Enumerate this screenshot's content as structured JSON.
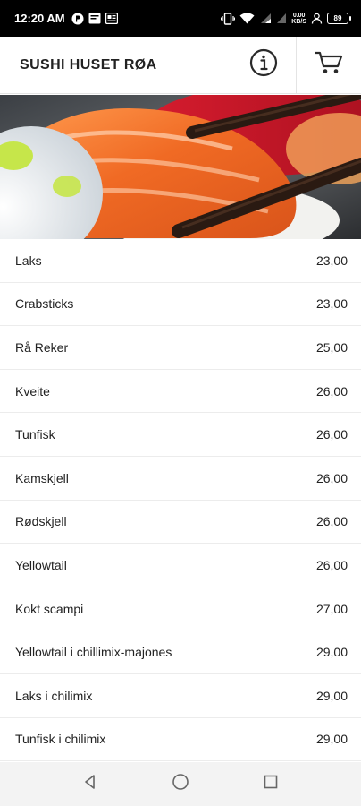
{
  "status_bar": {
    "time": "12:20 AM",
    "network_speed_value": "0.00",
    "network_speed_unit": "KB/S",
    "battery": "89",
    "icons": [
      "p-icon",
      "message-icon",
      "news-icon",
      "vibrate-icon",
      "wifi-icon",
      "signal-icon",
      "signal-icon-2",
      "person-icon"
    ]
  },
  "header": {
    "title": "SUSHI HUSET RØA",
    "icons": [
      "info-icon",
      "cart-icon"
    ]
  },
  "hero": {
    "icon": "sushi-photo"
  },
  "menu": {
    "items": [
      {
        "name": "Laks",
        "price": "23,00"
      },
      {
        "name": "Crabsticks",
        "price": "23,00"
      },
      {
        "name": "Rå Reker",
        "price": "25,00"
      },
      {
        "name": "Kveite",
        "price": "26,00"
      },
      {
        "name": "Tunfisk",
        "price": "26,00"
      },
      {
        "name": "Kamskjell",
        "price": "26,00"
      },
      {
        "name": "Rødskjell",
        "price": "26,00"
      },
      {
        "name": "Yellowtail",
        "price": "26,00"
      },
      {
        "name": "Kokt scampi",
        "price": "27,00"
      },
      {
        "name": "Yellowtail i chillimix-majones",
        "price": "29,00"
      },
      {
        "name": "Laks i chilimix",
        "price": "29,00"
      },
      {
        "name": "Tunfisk i chilimix",
        "price": "29,00"
      }
    ]
  },
  "nav_bar": {
    "icons": [
      "back-icon",
      "home-icon",
      "recents-icon"
    ]
  }
}
